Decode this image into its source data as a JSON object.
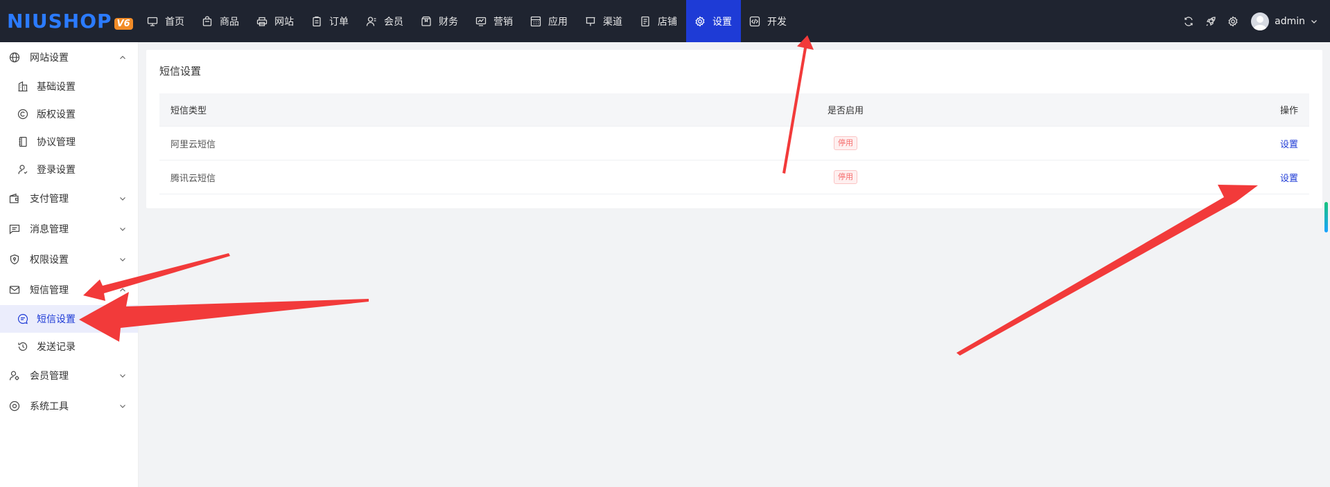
{
  "logo": {
    "text": "NIUSHOP",
    "badge": "V6"
  },
  "nav": [
    {
      "label": "首页",
      "icon": "monitor-icon"
    },
    {
      "label": "商品",
      "icon": "shop-bag-icon"
    },
    {
      "label": "网站",
      "icon": "printer-icon"
    },
    {
      "label": "订单",
      "icon": "clipboard-icon"
    },
    {
      "label": "会员",
      "icon": "user-icon"
    },
    {
      "label": "财务",
      "icon": "box-icon"
    },
    {
      "label": "营销",
      "icon": "chart-screen-icon"
    },
    {
      "label": "应用",
      "icon": "calculator-icon"
    },
    {
      "label": "渠道",
      "icon": "board-icon"
    },
    {
      "label": "店铺",
      "icon": "document-icon"
    },
    {
      "label": "设置",
      "icon": "gear-icon",
      "active": true
    },
    {
      "label": "开发",
      "icon": "code-icon"
    }
  ],
  "topbar": {
    "username": "admin",
    "icons": [
      "refresh-icon",
      "rocket-icon",
      "gear-icon"
    ]
  },
  "sidebar": {
    "groups": [
      {
        "label": "网站设置",
        "icon": "globe-icon",
        "expanded": true,
        "items": [
          {
            "label": "基础设置",
            "icon": "building-icon"
          },
          {
            "label": "版权设置",
            "icon": "copyright-icon"
          },
          {
            "label": "协议管理",
            "icon": "notebook-icon"
          },
          {
            "label": "登录设置",
            "icon": "user-icon"
          }
        ]
      },
      {
        "label": "支付管理",
        "icon": "wallet-icon",
        "expanded": false
      },
      {
        "label": "消息管理",
        "icon": "message-icon",
        "expanded": false
      },
      {
        "label": "权限设置",
        "icon": "shield-icon",
        "expanded": false
      },
      {
        "label": "短信管理",
        "icon": "mail-icon",
        "expanded": true,
        "items": [
          {
            "label": "短信设置",
            "icon": "chat-icon",
            "active": true
          },
          {
            "label": "发送记录",
            "icon": "history-icon"
          }
        ]
      },
      {
        "label": "会员管理",
        "icon": "user-gear-icon",
        "expanded": false
      },
      {
        "label": "系统工具",
        "icon": "target-icon",
        "expanded": false
      }
    ]
  },
  "main": {
    "title": "短信设置",
    "table": {
      "headers": [
        "短信类型",
        "是否启用",
        "操作"
      ],
      "rows": [
        {
          "type": "阿里云短信",
          "status": "停用",
          "action": "设置"
        },
        {
          "type": "腾讯云短信",
          "status": "停用",
          "action": "设置"
        }
      ]
    }
  },
  "colors": {
    "topbar": "#1f2430",
    "accent": "#1e3bd6",
    "annotation": "#f23a3a",
    "danger": "#f56c6c"
  }
}
